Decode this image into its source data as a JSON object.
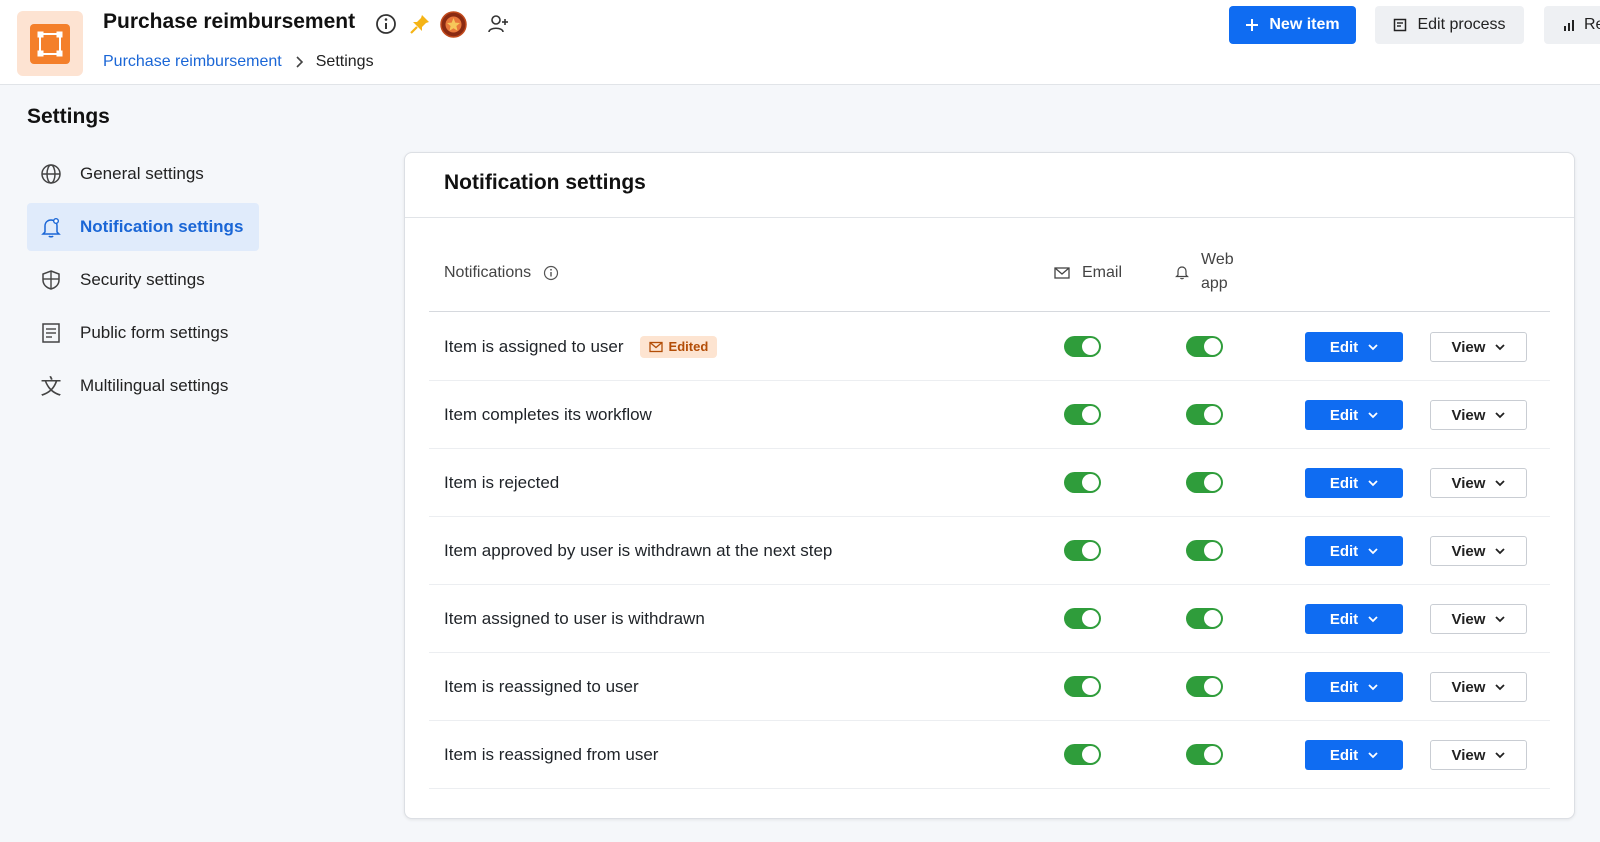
{
  "header": {
    "title": "Purchase reimbursement",
    "breadcrumb": {
      "parent": "Purchase reimbursement",
      "current": "Settings"
    },
    "new_item_label": "New item",
    "edit_process_label": "Edit process",
    "reports_label": "Re"
  },
  "sidebar": {
    "heading": "Settings",
    "items": [
      {
        "label": "General settings",
        "icon": "globe-icon",
        "active": false
      },
      {
        "label": "Notification settings",
        "icon": "bell-icon",
        "active": true
      },
      {
        "label": "Security settings",
        "icon": "shield-icon",
        "active": false
      },
      {
        "label": "Public form settings",
        "icon": "form-icon",
        "active": false
      },
      {
        "label": "Multilingual settings",
        "icon": "translate-icon",
        "active": false
      }
    ]
  },
  "main": {
    "title": "Notification settings",
    "columns": {
      "notifications": "Notifications",
      "email": "Email",
      "web_line1": "Web",
      "web_line2": "app"
    },
    "edit_label": "Edit",
    "view_label": "View",
    "edited_badge": "Edited",
    "rows": [
      {
        "label": "Item is assigned to user",
        "edited": true,
        "email": true,
        "web": true
      },
      {
        "label": "Item completes its workflow",
        "edited": false,
        "email": true,
        "web": true
      },
      {
        "label": "Item is rejected",
        "edited": false,
        "email": true,
        "web": true
      },
      {
        "label": "Item approved by user is withdrawn at the next step",
        "edited": false,
        "email": true,
        "web": true
      },
      {
        "label": "Item assigned to user is withdrawn",
        "edited": false,
        "email": true,
        "web": true
      },
      {
        "label": "Item is reassigned to user",
        "edited": false,
        "email": true,
        "web": true
      },
      {
        "label": "Item is reassigned from user",
        "edited": false,
        "email": true,
        "web": true
      }
    ]
  },
  "colors": {
    "accent": "#0f6cf2",
    "toggle_on": "#2f9d3b",
    "logo": "#f47f2a",
    "badge_bg": "#fde4d1",
    "badge_text": "#b34d07"
  }
}
